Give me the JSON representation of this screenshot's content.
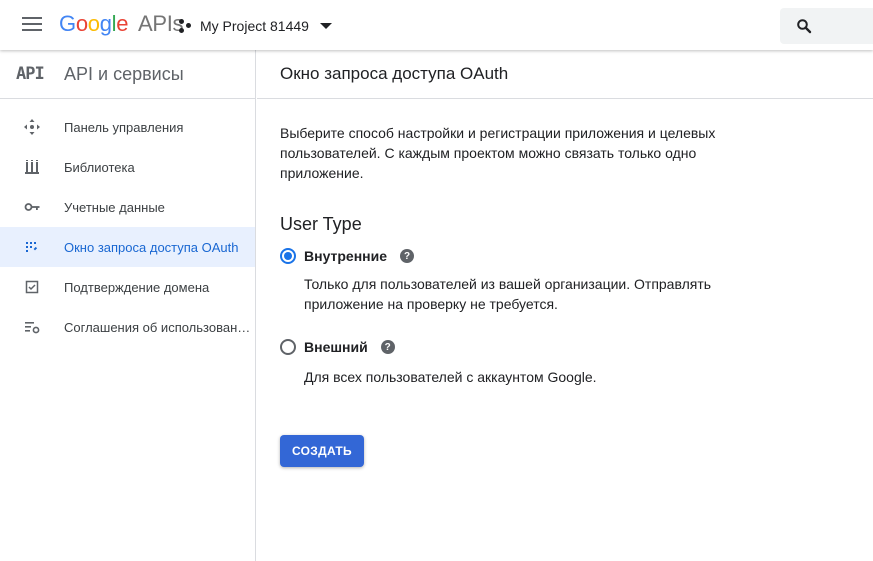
{
  "header": {
    "logo_google": "Google",
    "logo_apis": "APIs",
    "project_name": "My Project 81449",
    "search_icon": "search-icon",
    "menu_icon": "hamburger-menu-icon"
  },
  "sidebar": {
    "logo_text": "API",
    "title": "API и сервисы",
    "items": [
      {
        "label": "Панель управления",
        "icon": "dashboard-icon",
        "active": false
      },
      {
        "label": "Библиотека",
        "icon": "library-icon",
        "active": false
      },
      {
        "label": "Учетные данные",
        "icon": "key-icon",
        "active": false
      },
      {
        "label": "Окно запроса доступа OAuth",
        "icon": "oauth-consent-icon",
        "active": true
      },
      {
        "label": "Подтверждение домена",
        "icon": "domain-verification-icon",
        "active": false
      },
      {
        "label": "Соглашения об использовании страниц",
        "icon": "page-usage-agreements-icon",
        "active": false
      }
    ]
  },
  "main": {
    "title": "Окно запроса доступа OAuth",
    "description": "Выберите способ настройки и регистрации приложения и целевых пользователей. С каждым проектом можно связать только одно приложение.",
    "user_type_title": "User Type",
    "options": [
      {
        "label": "Внутренние",
        "selected": true,
        "description": "Только для пользователей из вашей организации. Отправлять приложение на проверку не требуется.",
        "help": "?"
      },
      {
        "label": "Внешний",
        "selected": false,
        "description": "Для всех пользователей с аккаунтом Google.",
        "help": "?"
      }
    ],
    "create_label": "СОЗДАТЬ"
  },
  "colors": {
    "accent": "#1a73e8",
    "button": "#3367d6",
    "active_bg": "#e8f0fe",
    "active_text": "#1967d2"
  }
}
